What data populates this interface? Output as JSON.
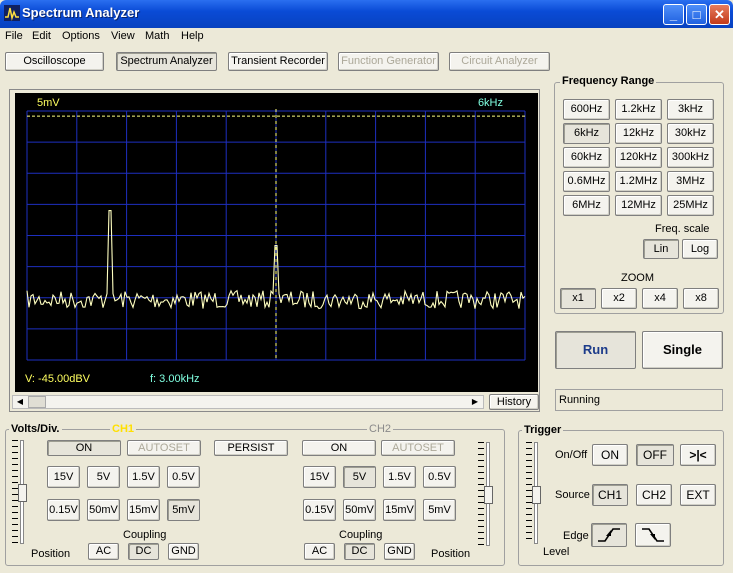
{
  "window": {
    "title": "Spectrum Analyzer"
  },
  "menu": [
    "File",
    "Edit",
    "Options",
    "View",
    "Math",
    "Help"
  ],
  "toolbar": [
    {
      "label": "Oscilloscope",
      "state": "normal"
    },
    {
      "label": "Spectrum Analyzer",
      "state": "pressed"
    },
    {
      "label": "Transient Recorder",
      "state": "normal"
    },
    {
      "label": "Function Generator",
      "state": "disabled"
    },
    {
      "label": "Circuit Analyzer",
      "state": "disabled"
    }
  ],
  "scope": {
    "vdiv_label": "5mV",
    "freq_label": "6kHz",
    "readout_v": "V: -45.00dBV",
    "readout_f": "f: 3.00kHz",
    "history_label": "History",
    "colors": {
      "background": "#000000",
      "grid": "#1e2fbf",
      "trace": "#ffffc0",
      "cursor": "#ffff80"
    }
  },
  "spectrum": {
    "freq_max_hz": 6000,
    "cursor_freq_hz": 3000,
    "reference_level_fraction": 0.125,
    "peaks": [
      {
        "freq_hz": 1000,
        "level_fraction": 0.6
      },
      {
        "freq_hz": 3000,
        "level_fraction": 0.46
      }
    ],
    "noise_floor_fraction": 0.21
  },
  "freq_range": {
    "title": "Frequency Range",
    "buttons": [
      "600Hz",
      "1.2kHz",
      "3kHz",
      "6kHz",
      "12kHz",
      "30kHz",
      "60kHz",
      "120kHz",
      "300kHz",
      "0.6MHz",
      "1.2MHz",
      "3MHz",
      "6MHz",
      "12MHz",
      "25MHz"
    ],
    "selected": "6kHz",
    "scale_label": "Freq. scale",
    "scale_options": [
      "Lin",
      "Log"
    ],
    "scale_selected": "Lin",
    "zoom_label": "ZOOM",
    "zoom_options": [
      "x1",
      "x2",
      "x4",
      "x8"
    ],
    "zoom_selected": "x1"
  },
  "run": {
    "run_label": "Run",
    "single_label": "Single",
    "status": "Running"
  },
  "volts": {
    "title": "Volts/Div.",
    "ch1_label": "CH1",
    "ch2_label": "CH2",
    "on_label": "ON",
    "autoset_label": "AUTOSET",
    "persist_label": "PERSIST",
    "scales": [
      "15V",
      "5V",
      "1.5V",
      "0.5V",
      "0.15V",
      "50mV",
      "15mV",
      "5mV"
    ],
    "ch1_selected": "5mV",
    "ch2_selected": "5V",
    "coupling_label": "Coupling",
    "coupling_options": [
      "AC",
      "DC",
      "GND"
    ],
    "coupling_selected": "DC",
    "position_label": "Position"
  },
  "trigger": {
    "title": "Trigger",
    "onoff_label": "On/Off",
    "on_label": "ON",
    "off_label": "OFF",
    "onoff_selected": "OFF",
    "cross_symbol": ">|<",
    "source_label": "Source",
    "sources": [
      "CH1",
      "CH2",
      "EXT"
    ],
    "source_selected": "CH1",
    "edge_label": "Edge",
    "level_label": "Level"
  }
}
